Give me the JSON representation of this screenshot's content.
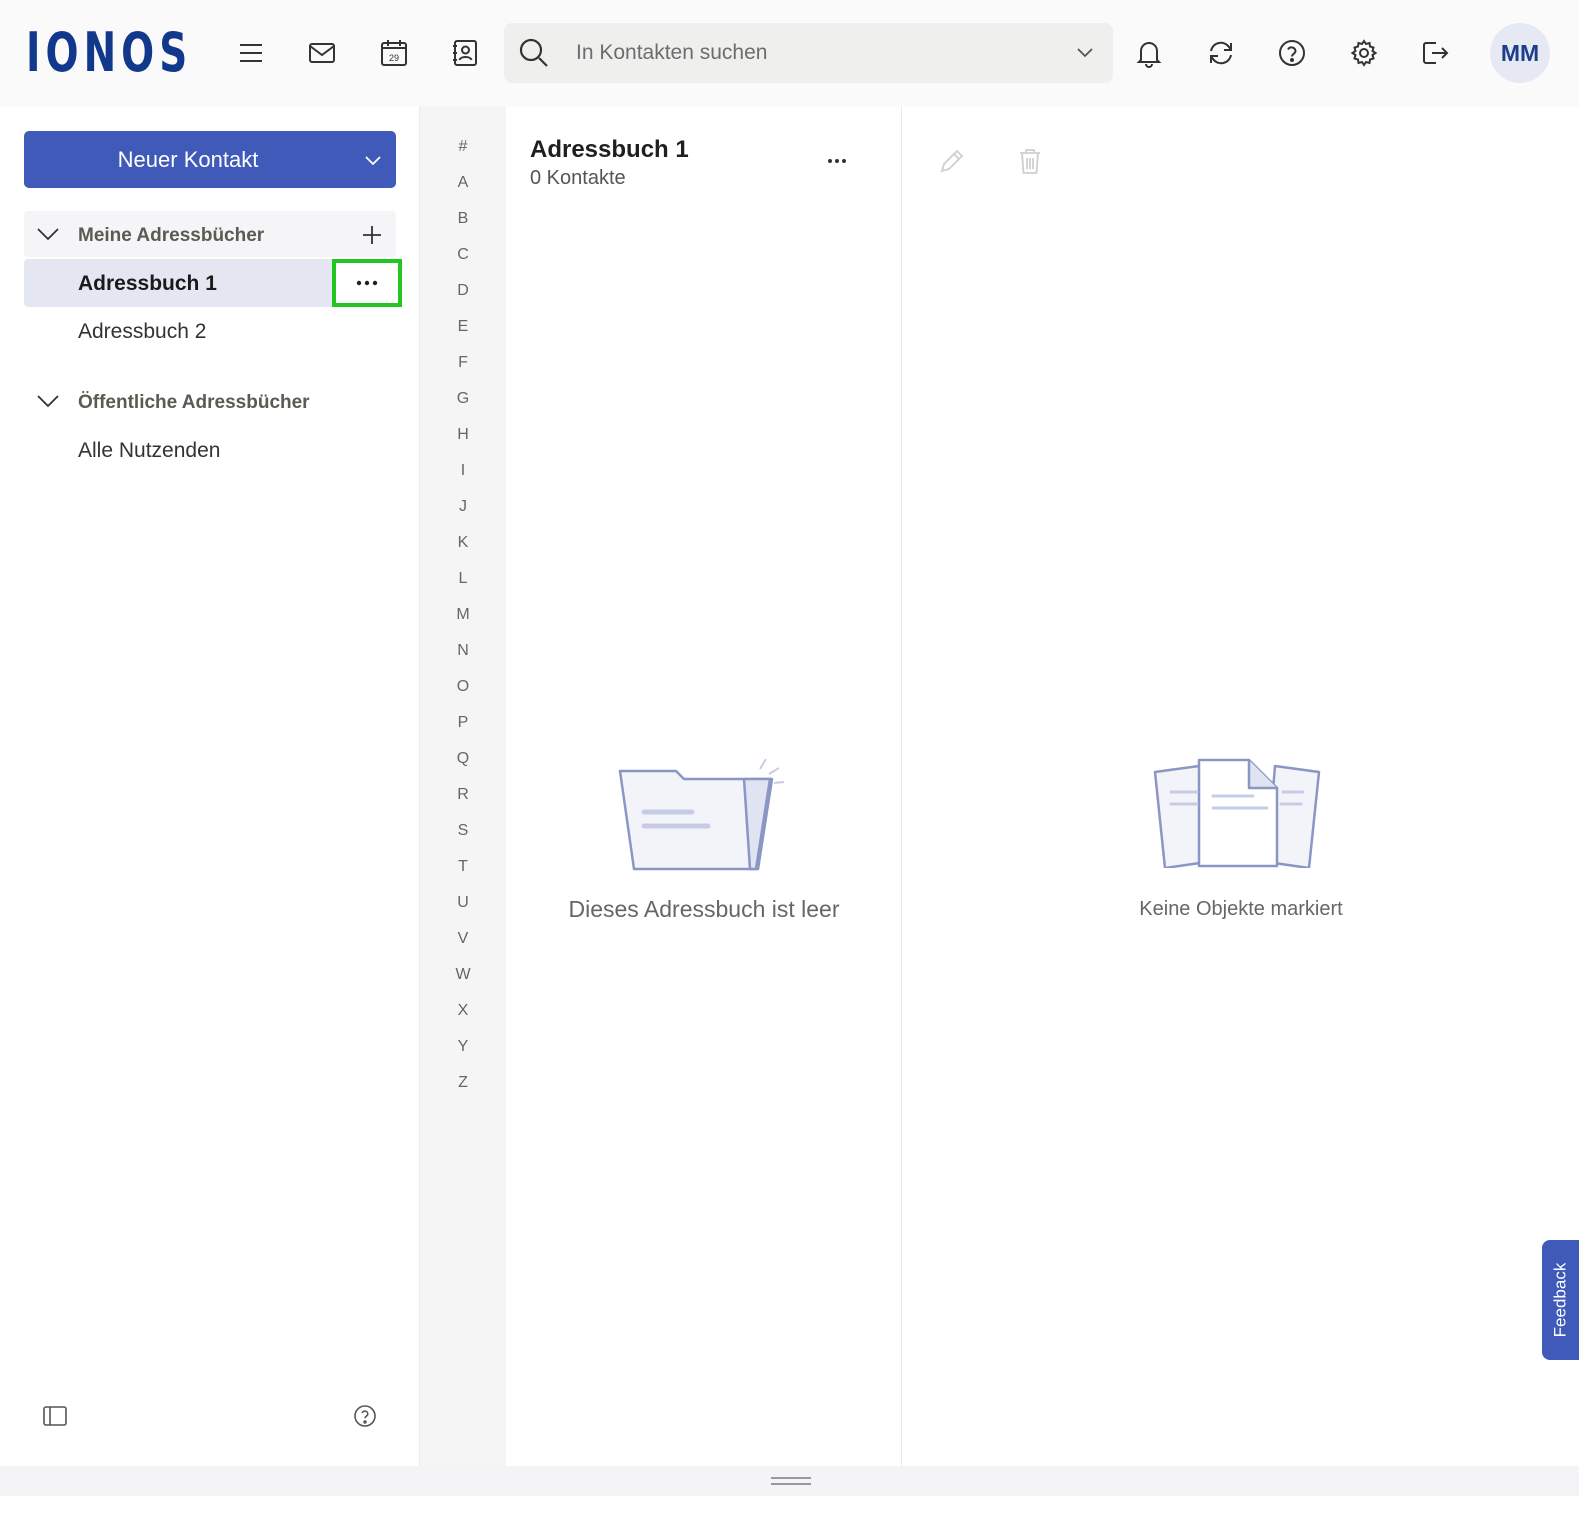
{
  "header": {
    "logo": "IONOS",
    "icons": [
      "menu-icon",
      "mail-icon",
      "calendar-icon",
      "contacts-icon",
      "bell-icon",
      "sync-icon",
      "help-icon",
      "settings-icon",
      "logout-icon"
    ],
    "calendar_day": "29",
    "search": {
      "placeholder": "In Kontakten suchen",
      "value": ""
    },
    "avatar_initials": "MM"
  },
  "sidebar": {
    "new_button_label": "Neuer Kontakt",
    "my_books": {
      "label": "Meine Adressbücher",
      "items": [
        {
          "label": "Adressbuch 1",
          "active": true
        },
        {
          "label": "Adressbuch 2",
          "active": false
        }
      ]
    },
    "public_books": {
      "label": "Öffentliche Adressbücher",
      "items": [
        {
          "label": "Alle Nutzenden"
        }
      ]
    }
  },
  "alphabet": [
    "#",
    "A",
    "B",
    "C",
    "D",
    "E",
    "F",
    "G",
    "H",
    "I",
    "J",
    "K",
    "L",
    "M",
    "N",
    "O",
    "P",
    "Q",
    "R",
    "S",
    "T",
    "U",
    "V",
    "W",
    "X",
    "Y",
    "Z"
  ],
  "list": {
    "title": "Adressbuch 1",
    "count": "0 Kontakte",
    "empty_text": "Dieses Adressbuch ist leer"
  },
  "detail": {
    "empty_text": "Keine Objekte markiert"
  },
  "feedback_label": "Feedback",
  "colors": {
    "brand": "#11388a",
    "accent": "#3f5ab8",
    "highlight": "#23c523"
  }
}
